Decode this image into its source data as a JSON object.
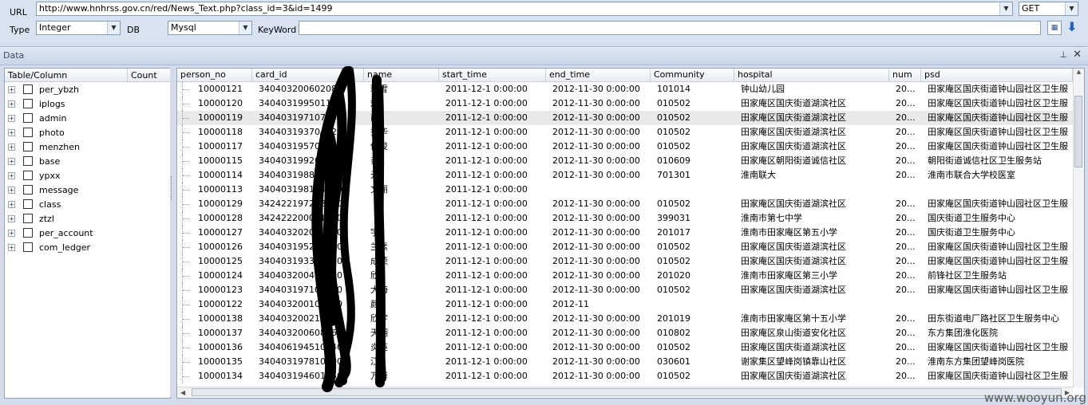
{
  "toolbar": {
    "url_label": "URL",
    "url_value": "http://www.hnhrss.gov.cn/red/News_Text.php?class_id=3&id=1499",
    "method": "GET",
    "type_label": "Type",
    "type_value": "Integer",
    "db_label": "DB",
    "db_value": "Mysql",
    "keyword_label": "KeyWord",
    "keyword_value": ""
  },
  "data_panel": {
    "title": "Data",
    "pin_icon": "pin-icon",
    "close_icon": "close-icon"
  },
  "tree": {
    "headers": [
      "Table/Column",
      "Count"
    ],
    "items": [
      "per_ybzh",
      "iplogs",
      "admin",
      "photo",
      "menzhen",
      "base",
      "ypxx",
      "message",
      "class",
      "ztzl",
      "per_account",
      "com_ledger"
    ]
  },
  "grid": {
    "columns": [
      "person_no",
      "card_id",
      "name",
      "start_time",
      "end_time",
      "Community",
      "hospital",
      "num",
      "psd"
    ],
    "rows": [
      [
        "10000121",
        "340403200602080",
        "瑞雪",
        "2011-12-1 0:00:00",
        "2012-11-30 0:00:00",
        "101014",
        "钟山幼儿园",
        "20...",
        "田家庵区国庆街道钟山园社区卫生服"
      ],
      [
        "10000120",
        "340403199501132",
        "斌",
        "2011-12-1 0:00:00",
        "2012-11-30 0:00:00",
        "010502",
        "田家庵区国庆街道湖滨社区",
        "20...",
        "田家庵区国庆街道钟山园社区卫生服"
      ],
      [
        "10000119",
        "340403197107102",
        "南",
        "2011-12-1 0:00:00",
        "2012-11-30 0:00:00",
        "010502",
        "田家庵区国庆街道湖滨社区",
        "20...",
        "田家庵区国庆街道钟山园社区卫生服"
      ],
      [
        "10000118",
        "340403193704220",
        "秀华",
        "2011-12-1 0:00:00",
        "2012-11-30 0:00:00",
        "010502",
        "田家庵区国庆街道湖滨社区",
        "20...",
        "田家庵区国庆街道钟山园社区卫生服"
      ],
      [
        "10000117",
        "340403195704180",
        "传俊",
        "2011-12-1 0:00:00",
        "2012-11-30 0:00:00",
        "010502",
        "田家庵区国庆街道湖滨社区",
        "20...",
        "田家庵区国庆街道钟山园社区卫生服"
      ],
      [
        "10000115",
        "340403199206110",
        "亲",
        "2011-12-1 0:00:00",
        "2012-11-30 0:00:00",
        "010609",
        "田家庵区朝阳街道诚信社区",
        "20...",
        "朝阳街道诚信社区卫生服务站"
      ],
      [
        "10000114",
        "340403198802250",
        "元",
        "2011-12-1 0:00:00",
        "2012-11-30 0:00:00",
        "701301",
        "淮南联大",
        "20...",
        "淮南市联合大学校医室"
      ],
      [
        "10000113",
        "340403198104010",
        "文丽",
        "2011-12-1 0:00:00",
        "",
        "",
        "",
        "",
        ""
      ],
      [
        "10000129",
        "342422197208060",
        "",
        "2011-12-1 0:00:00",
        "2012-11-30 0:00:00",
        "010502",
        "田家庵区国庆街道湖滨社区",
        "20...",
        "田家庵区国庆街道钟山园社区卫生服"
      ],
      [
        "10000128",
        "342422200001060",
        "",
        "2011-12-1 0:00:00",
        "2012-11-30 0:00:00",
        "399031",
        "淮南市第七中学",
        "20...",
        "国庆街道卫生服务中心"
      ],
      [
        "10000127",
        "340403202040200",
        "宇",
        "2011-12-1 0:00:00",
        "2012-11-30 0:00:00",
        "201017",
        "淮南市田家庵区第五小学",
        "20...",
        "国庆街道卫生服务中心"
      ],
      [
        "10000126",
        "340403195212050",
        "兰素",
        "2011-12-1 0:00:00",
        "2012-11-30 0:00:00",
        "010502",
        "田家庵区国庆街道湖滨社区",
        "20...",
        "田家庵区国庆街道钟山园社区卫生服"
      ],
      [
        "10000125",
        "340403193311040",
        "成荣",
        "2011-12-1 0:00:00",
        "2012-11-30 0:00:00",
        "010502",
        "田家庵区国庆街道湖滨社区",
        "20...",
        "田家庵区国庆街道钟山园社区卫生服"
      ],
      [
        "10000124",
        "340403200410220",
        "欣",
        "2011-12-1 0:00:00",
        "2012-11-30 0:00:00",
        "201020",
        "淮南市田家庵区第三小学",
        "20...",
        "前锋社区卫生服务站"
      ],
      [
        "10000123",
        "340403197107100",
        "大海",
        "2011-12-1 0:00:00",
        "2012-11-30 0:00:00",
        "010502",
        "田家庵区国庆街道湖滨社区",
        "20...",
        "田家庵区国庆街道钟山园社区卫生服"
      ],
      [
        "10000122",
        "340403200102020",
        "颜",
        "2011-12-1 0:00:00",
        "2012-11",
        "",
        "",
        "",
        ""
      ],
      [
        "10000138",
        "340403200210100",
        "欣宇",
        "2011-12-1 0:00:00",
        "2012-11-30 0:00:00",
        "201019",
        "淮南市田家庵区第十五小学",
        "20...",
        "田东街道电厂路社区卫生服务中心"
      ],
      [
        "10000137",
        "340403200608060",
        "天翔",
        "2011-12-1 0:00:00",
        "2012-11-30 0:00:00",
        "010802",
        "田家庵区泉山街道安化社区",
        "20...",
        "东方集团淮化医院"
      ],
      [
        "10000136",
        "340406194510040",
        "炎英",
        "2011-12-1 0:00:00",
        "2012-11-30 0:00:00",
        "010502",
        "田家庵区国庆街道湖滨社区",
        "20...",
        "田家庵区国庆街道钟山园社区卫生服"
      ],
      [
        "10000135",
        "340403197810200",
        "江",
        "2011-12-1 0:00:00",
        "2012-11-30 0:00:00",
        "030601",
        "谢家集区望峰岗镇靠山社区",
        "20...",
        "淮南东方集团望峰岗医院"
      ],
      [
        "10000134",
        "340403194601250",
        "万华",
        "2011-12-1 0:00:00",
        "2012-11-30 0:00:00",
        "010502",
        "田家庵区国庆街道湖滨社区",
        "20...",
        "田家庵区国庆街道钟山园社区卫生服"
      ]
    ]
  },
  "watermark": "www.wooyun.org"
}
